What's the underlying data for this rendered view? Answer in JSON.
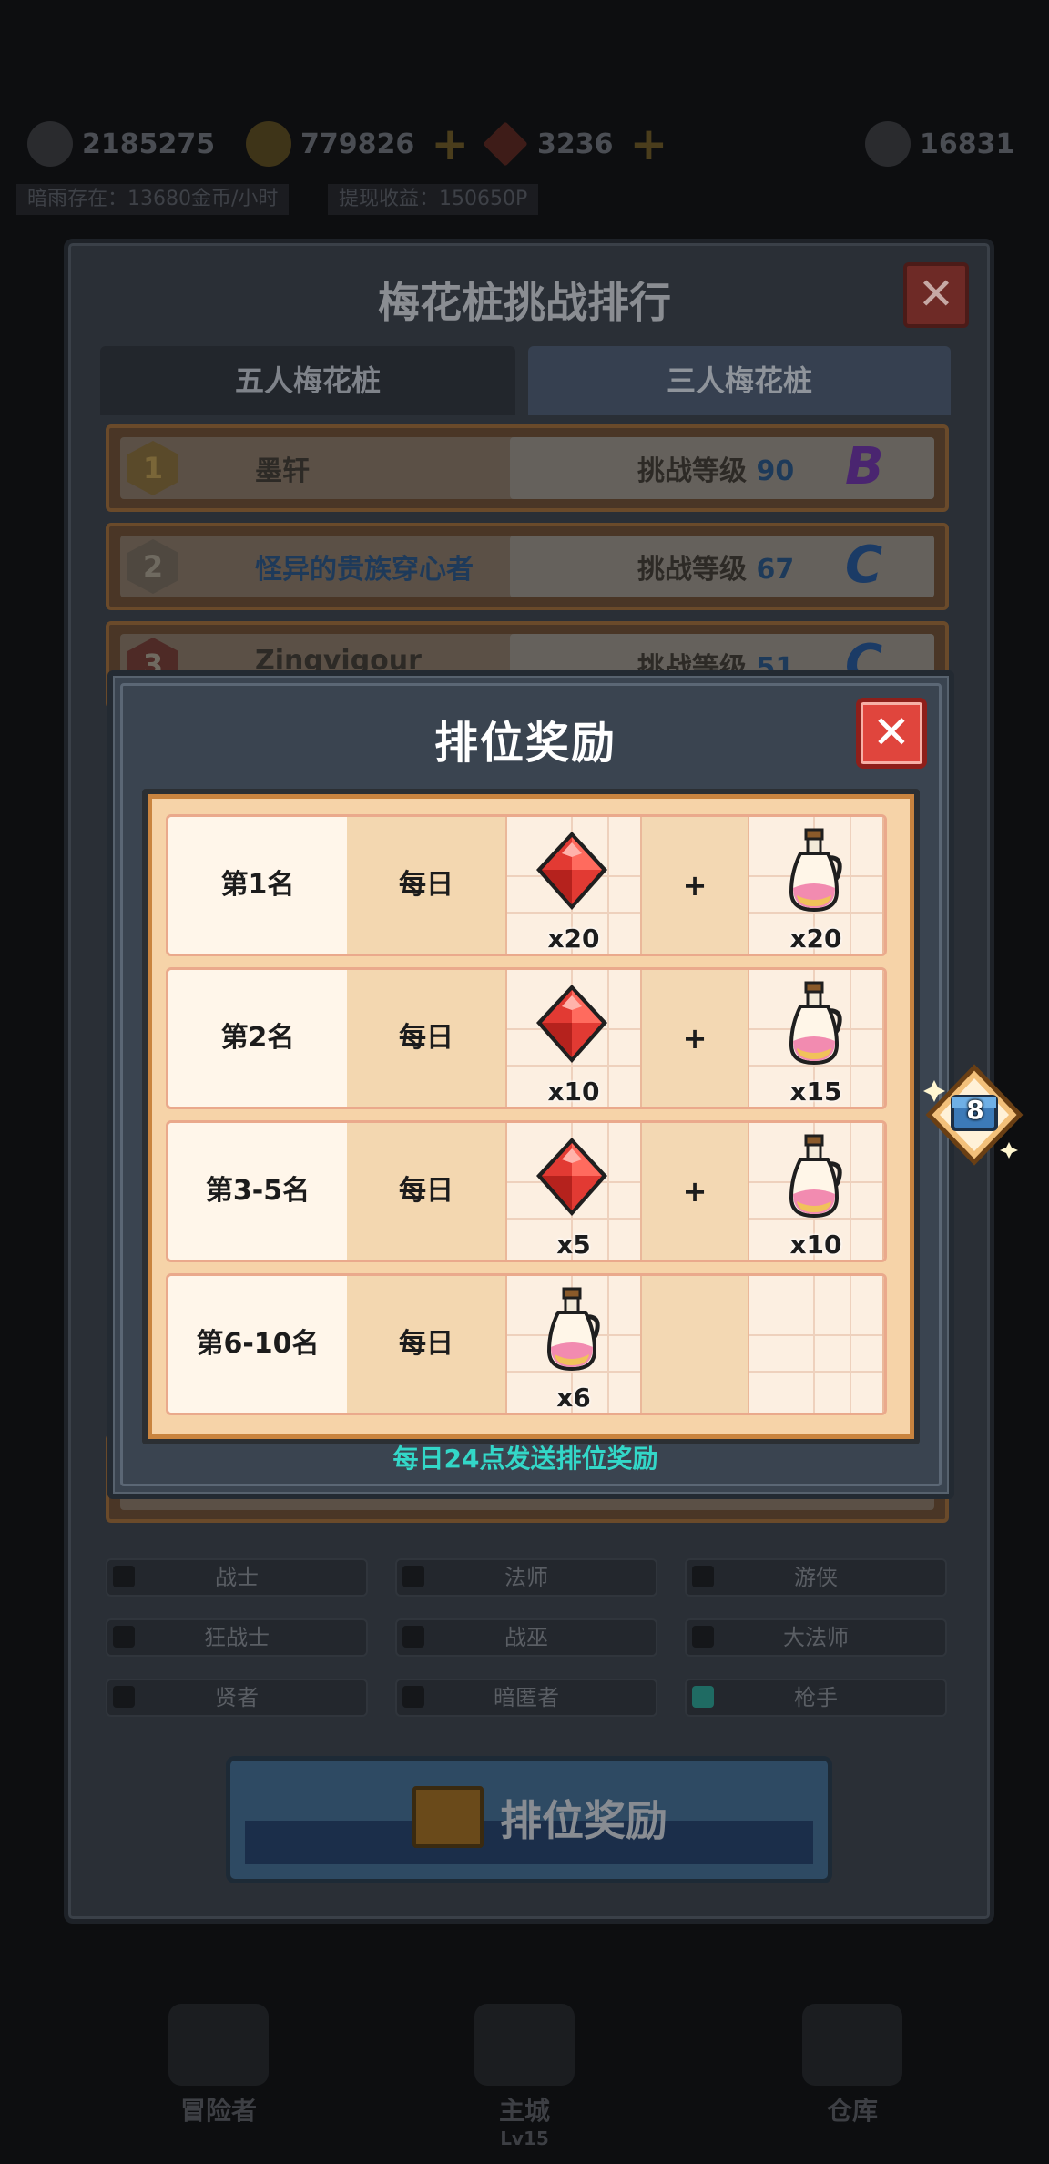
{
  "hud": {
    "res1_value": "2185275",
    "res2_value": "779826",
    "res3_value": "3236",
    "res4_value": "16831",
    "info1": "暗雨存在：13680金币/小时",
    "info2": "提现收益：150650P"
  },
  "bg_panel": {
    "title": "梅花桩挑战排行",
    "close_glyph": "✕",
    "tabs": [
      "五人梅花桩",
      "三人梅花桩"
    ],
    "level_label": "挑战等级",
    "rows": [
      {
        "rank": "1",
        "name": "墨轩",
        "level": "90",
        "grade": "B"
      },
      {
        "rank": "2",
        "name": "怪异的贵族穿心者",
        "level": "67",
        "grade": "C"
      },
      {
        "rank": "3",
        "name": "Zingvigour",
        "level": "51",
        "grade": "C"
      }
    ],
    "classes": [
      "战士",
      "法师",
      "游侠",
      "狂战士",
      "战巫",
      "大法师",
      "贤者",
      "暗匿者",
      "枪手"
    ],
    "reward_button": "排位奖励",
    "nav": [
      "冒险者",
      "主城",
      "仓库"
    ],
    "nav_sub": "Lv15"
  },
  "dialog": {
    "title": "排位奖励",
    "close_glyph": "✕",
    "footnote": "每日24点发送排位奖励",
    "rows": [
      {
        "rank": "第1名",
        "freq": "每日",
        "item1_icon": "ruby-gem-icon",
        "item1_qty": "x20",
        "plus": "+",
        "item2_icon": "potion-jug-icon",
        "item2_qty": "x20"
      },
      {
        "rank": "第2名",
        "freq": "每日",
        "item1_icon": "ruby-gem-icon",
        "item1_qty": "x10",
        "plus": "+",
        "item2_icon": "potion-jug-icon",
        "item2_qty": "x15"
      },
      {
        "rank": "第3-5名",
        "freq": "每日",
        "item1_icon": "ruby-gem-icon",
        "item1_qty": "x5",
        "plus": "+",
        "item2_icon": "potion-jug-icon",
        "item2_qty": "x10"
      },
      {
        "rank": "第6-10名",
        "freq": "每日",
        "item1_icon": "potion-jug-icon",
        "item1_qty": "x6",
        "plus": "",
        "item2_icon": "",
        "item2_qty": ""
      }
    ]
  },
  "side_badge": {
    "value": "8"
  },
  "colors": {
    "accent_teal": "#33d7c8",
    "close_red": "#e0453d",
    "table_bg": "#f6d3a8",
    "grade_b": "#5a2a8a",
    "grade_c": "#1d4f8a"
  }
}
